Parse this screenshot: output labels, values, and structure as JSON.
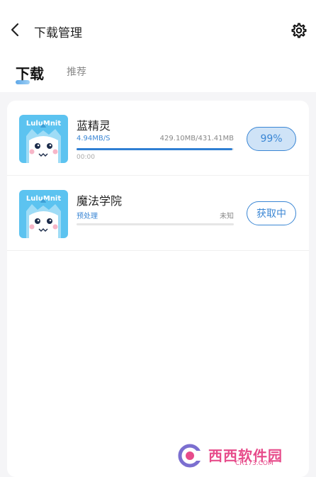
{
  "header": {
    "title": "下载管理",
    "back_icon": "chevron-left-icon",
    "settings_icon": "gear-icon"
  },
  "tabs": [
    {
      "label": "下载",
      "active": true
    },
    {
      "label": "推荐",
      "active": false
    }
  ],
  "downloads": [
    {
      "name": "蓝精灵",
      "app_logo_text": "LuluMnit",
      "speed": "4.94MB/S",
      "size": "429.10MB/431.41MB",
      "progress": 0.99,
      "time": "00:00",
      "button_label": "99%"
    },
    {
      "name": "魔法学院",
      "app_logo_text": "LuluMnit",
      "status": "预处理",
      "size": "未知",
      "progress": 0,
      "button_label": "获取中"
    }
  ],
  "watermark": {
    "brand": "西西软件园",
    "domain": "CR173.COM"
  },
  "colors": {
    "accent": "#3a86d4",
    "progress_fill": "#2f7fd3",
    "thumb_bg": "#5cc3f0",
    "background": "#f5f5f7"
  }
}
